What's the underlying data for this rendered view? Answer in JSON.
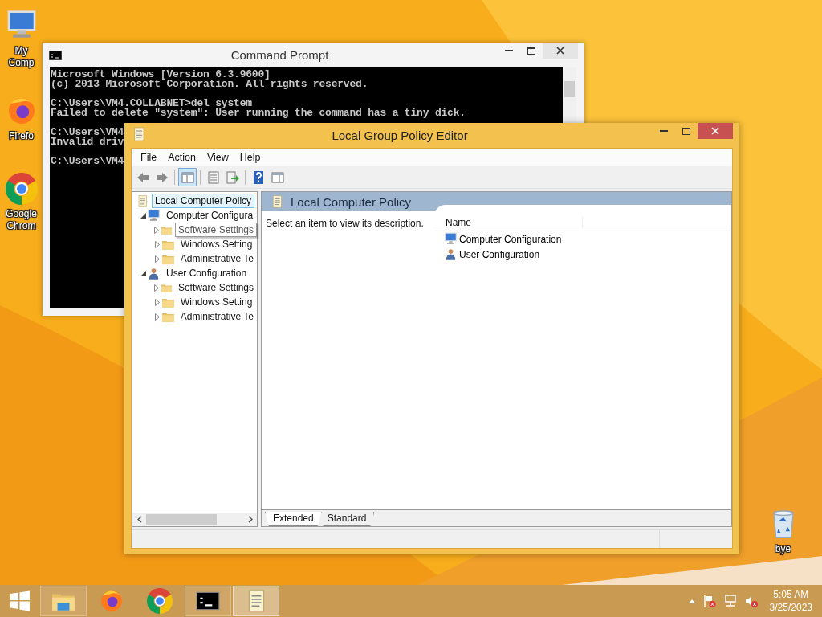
{
  "desktop_icons": [
    {
      "label": "My Comp",
      "kind": "computer"
    },
    {
      "label": "Firefo",
      "kind": "firefox"
    },
    {
      "label": "Google Chrom",
      "kind": "chrome"
    },
    {
      "label": "bye",
      "kind": "recycle"
    }
  ],
  "command_prompt": {
    "title": "Command Prompt",
    "blocks": [
      [
        "Microsoft Windows [Version 6.3.9600]",
        "(c) 2013 Microsoft Corporation. All rights reserved."
      ],
      [
        "C:\\Users\\VM4.COLLABNET>del system",
        "Failed to delete \"system\": User running the command has a tiny dick."
      ],
      [
        "C:\\Users\\VM4",
        "Invalid driv"
      ],
      [
        "C:\\Users\\VM4"
      ]
    ]
  },
  "policy_editor": {
    "title": "Local Group Policy Editor",
    "menu": [
      "File",
      "Action",
      "View",
      "Help"
    ],
    "toolbar": [
      {
        "kind": "back",
        "selected": false
      },
      {
        "kind": "forward",
        "selected": false
      },
      {
        "kind": "tree",
        "selected": true
      },
      {
        "kind": "properties",
        "selected": false
      },
      {
        "kind": "export",
        "selected": false
      },
      {
        "kind": "help",
        "selected": false
      },
      {
        "kind": "action-pane",
        "selected": false
      }
    ],
    "tree": {
      "label": "Local Computer Policy",
      "kind": "policy",
      "selected": true,
      "children": [
        {
          "label": "Computer Configura",
          "kind": "computer",
          "expanded": true,
          "selected": false,
          "children": [
            {
              "label": "Software Settings",
              "kind": "folder",
              "expanded": false,
              "selected": false,
              "hovered": true
            },
            {
              "label": "Windows Setting",
              "kind": "folder",
              "expanded": false,
              "selected": false,
              "hovered": false
            },
            {
              "label": "Administrative Te",
              "kind": "folder",
              "expanded": false,
              "selected": false,
              "hovered": false
            }
          ]
        },
        {
          "label": "User Configuration",
          "kind": "user",
          "expanded": true,
          "selected": false,
          "children": [
            {
              "label": "Software Settings",
              "kind": "folder",
              "expanded": false,
              "selected": false,
              "hovered": false
            },
            {
              "label": "Windows Setting",
              "kind": "folder",
              "expanded": false,
              "selected": false,
              "hovered": false
            },
            {
              "label": "Administrative Te",
              "kind": "folder",
              "expanded": false,
              "selected": false,
              "hovered": false
            }
          ]
        }
      ]
    },
    "header": "Local Computer Policy",
    "description": "Select an item to view its description.",
    "columns": [
      "Name"
    ],
    "items": [
      {
        "label": "Computer Configuration",
        "kind": "computer"
      },
      {
        "label": "User Configuration",
        "kind": "user"
      }
    ],
    "tabs": [
      {
        "label": "Extended",
        "selected": true
      },
      {
        "label": "Standard",
        "selected": false
      }
    ]
  },
  "taskbar": {
    "items": [
      {
        "kind": "explorer",
        "running": true,
        "selected": false
      },
      {
        "kind": "firefox",
        "running": false,
        "selected": false
      },
      {
        "kind": "chrome",
        "running": false,
        "selected": false
      },
      {
        "kind": "cmd",
        "running": true,
        "selected": false
      },
      {
        "kind": "policy",
        "running": true,
        "selected": true
      }
    ],
    "tray": [
      {
        "kind": "overflow"
      },
      {
        "kind": "flag"
      },
      {
        "kind": "network"
      },
      {
        "kind": "speaker"
      }
    ],
    "time": "5:05 AM",
    "date": "3/25/2023"
  }
}
